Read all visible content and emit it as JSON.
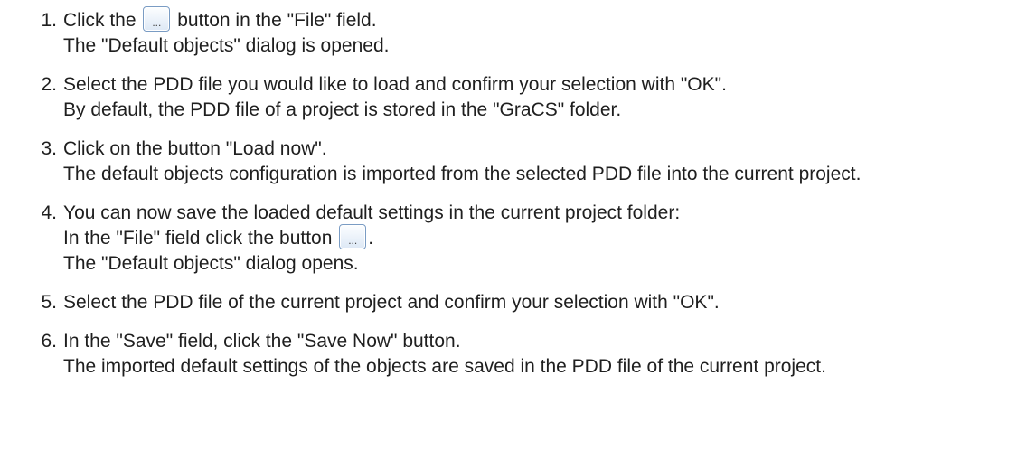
{
  "steps": [
    {
      "num": "1",
      "l1_before": "Click the ",
      "l1_after": " button in the \"File\" field.",
      "l2": "The \"Default objects\" dialog is opened."
    },
    {
      "num": "2",
      "l1": "Select the PDD file you would like to load and confirm your selection with \"OK\".",
      "l2": "By default, the PDD file of a project is stored in the \"GraCS\" folder."
    },
    {
      "num": "3",
      "l1": "Click on the button \"Load now\".",
      "l2": "The default objects configuration is imported from the selected PDD file into the current project."
    },
    {
      "num": "4",
      "l1": "You can now save the loaded default settings in the current project folder:",
      "l2_before": "In the \"File\" field click the button ",
      "l2_after": ".",
      "l3": "The \"Default objects\" dialog opens."
    },
    {
      "num": "5",
      "l1": "Select the PDD file of the current project and confirm your selection with \"OK\"."
    },
    {
      "num": "6",
      "l1": "In the \"Save\" field, click the \"Save Now\" button.",
      "l2": "The imported default settings of the objects are saved in the PDD file of the current project."
    }
  ],
  "browse_button": {
    "label": "..."
  }
}
